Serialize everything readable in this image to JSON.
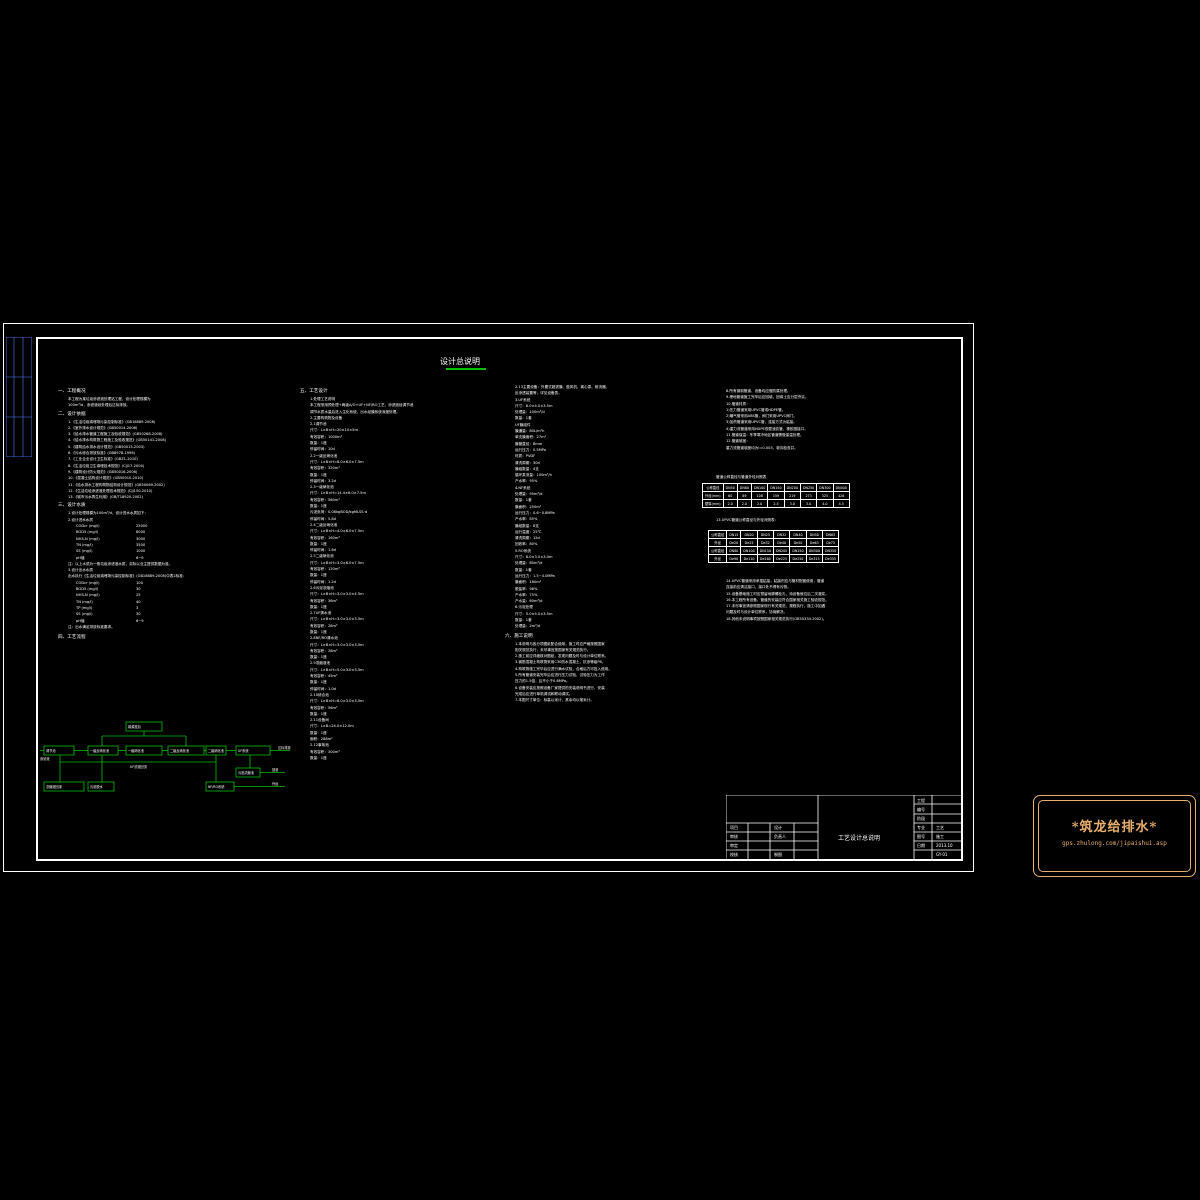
{
  "drawing": {
    "title": "设计总说明",
    "line_color": "#00c000",
    "text_color": "#ffffff"
  },
  "section1": {
    "heading": "一、工程概况",
    "lines": [
      "本工程为某垃圾渗滤液处理站工程，设计处理规模为",
      "100m³/d，渗滤液经处理后达标排放。"
    ]
  },
  "section2": {
    "heading": "二、设计依据",
    "lines": [
      "1.《生活垃圾填埋场污染控制标准》(GB16889-2008)",
      "2.《室外排水设计规范》(GB50014-2006)",
      "3.《给水排水管道工程施工及验收规范》(GB50268-2008)",
      "4.《给水排水构筑物工程施工及验收规范》(GB50141-2008)",
      "5.《建筑给水排水设计规范》(GB50015-2003)",
      "6.《污水综合排放标准》(GB8978-1996)",
      "7.《工业企业设计卫生标准》(GBZ1-2010)",
      "8.《生活垃圾卫生填埋技术规范》(CJJ17-2004)",
      "9.《建筑设计防火规范》(GB50016-2006)",
      "10.《混凝土结构设计规范》(GB50010-2010)",
      "11.《给水排水工程构筑物结构设计规范》(GB50069-2002)",
      "12.《生活垃圾渗滤液处理技术规范》(CJJ150-2010)",
      "13.《城市污水再生利用》(GB/T18920-2002)"
    ]
  },
  "section3": {
    "heading": "三、设计水质",
    "intro": "1.设计处理规模为100m³/d，设计进水水质如下：",
    "inlet_title": "2.设计进水水质",
    "inlet": [
      {
        "name": "CODcr (mg/l)",
        "value": "25000"
      },
      {
        "name": "BOD5 (mg/l)",
        "value": "8000"
      },
      {
        "name": "NH3-N (mg/l)",
        "value": "3000"
      },
      {
        "name": "TN (mg/l)",
        "value": "3500"
      },
      {
        "name": "SS (mg/l)",
        "value": "1000"
      },
      {
        "name": "pH值",
        "value": "6~9"
      }
    ],
    "note1": "注：以上水质为一般垃圾渗滤液水质，实际以业主提供数据为准。",
    "outlet_title": "3.设计出水水质",
    "outlet_intro": "出水执行《生活垃圾填埋场污染控制标准》(GB16889-2008)中表2标准：",
    "outlet": [
      {
        "name": "CODcr (mg/l)",
        "value": "100"
      },
      {
        "name": "BOD5 (mg/l)",
        "value": "30"
      },
      {
        "name": "NH3-N (mg/l)",
        "value": "25"
      },
      {
        "name": "TN (mg/l)",
        "value": "40"
      },
      {
        "name": "TP (mg/l)",
        "value": "3"
      },
      {
        "name": "SS (mg/l)",
        "value": "30"
      },
      {
        "name": "pH值",
        "value": "6~9"
      }
    ],
    "note2": "注：出水满足排放标准要求。"
  },
  "section4": {
    "heading": "四、工艺流程",
    "flow": {
      "b1": "调节池",
      "b2": "一级反硝化池",
      "b3": "一级硝化池",
      "b4": "二级反硝化池",
      "b5": "二级硝化池",
      "b6": "UF系统",
      "b7": "NF/RO系统",
      "top": "碳源投加",
      "sludge": "污泥浓缩池",
      "sludge2": "污泥脱水",
      "conc": "浓缩液回灌",
      "return": "UF浓液回流",
      "out1": "达标排放",
      "out2": "回灌",
      "out3": "外运",
      "in": "渗滤液"
    }
  },
  "section5": {
    "heading": "五、工艺设计",
    "lines": [
      "1.处理工艺说明",
      "本工程采用预处理+两级A/O+UF+NF/RO工艺，渗滤液经调节池",
      "调节水质水量后进入生化系统，出水经膜系统深度处理。",
      "2.主要构筑物及设备",
      "2.1调节池",
      "尺寸：L×B×H=20×10×5m",
      "有效容积：1000m³",
      "数量：1座",
      "停留时间：10d",
      "2.2一级反硝化池",
      "尺寸：L×B×H=8.0×6.0×7.5m",
      "有效容积：320m³",
      "数量：1座",
      "停留时间：3.2d",
      "2.3一级硝化池",
      "尺寸：L×B×H=14.4×6.0×7.5m",
      "有效容积：580m³",
      "数量：1座",
      "污泥负荷：0.08kgBOD/kgMLSS·d",
      "停留时间：5.8d",
      "2.4二级反硝化池",
      "尺寸：L×B×H=4.0×6.0×7.5m",
      "有效容积：160m³",
      "数量：1座",
      "停留时间：1.6d",
      "2.5二级硝化池",
      "尺寸：L×B×H=3.0×6.0×7.5m",
      "有效容积：120m³",
      "数量：1座",
      "停留时间：1.2d",
      "2.6污泥浓缩池",
      "尺寸：L×B×H=3.0×3.0×4.5m",
      "有效容积：36m³",
      "数量：1座",
      "2.7UF清水池",
      "尺寸：L×B×H=3.0×3.0×3.5m",
      "有效容积：28m³",
      "数量：1座",
      "2.8NF/RO清水池",
      "尺寸：L×B×H=3.0×3.0×3.5m",
      "有效容积：28m³",
      "数量：1座",
      "2.9浓缩液池",
      "尺寸：L×B×H=5.0×3.0×3.5m",
      "有效容积：45m³",
      "数量：1座",
      "停留时间：1.0d",
      "2.10综合池",
      "尺寸：L×B×H=6.0×3.0×3.5m",
      "有效容积：56m³",
      "数量：1座",
      "2.11设备间",
      "尺寸：L×B=24.0×12.0m",
      "数量：1座",
      "面积：288m²",
      "2.12事故池",
      "有效容积：300m³",
      "数量：1座"
    ]
  },
  "section5b": {
    "lines": [
      "2.13主要设备：外置式超滤膜、鼓风机、离心泵、射流器、",
      "反渗透装置等，详见设备表。",
      "3.UF系统",
      "尺寸：8.0×4.0×3.5m",
      "处理量：100m³/d",
      "数量：1套",
      "UF膜组件",
      "膜通量：80L/m²h",
      "单支膜面积：27m²",
      "膜管直径：8mm",
      "运行压力：0.5MPa",
      "材质：PVDF",
      "清洗周期：30d",
      "膜组数量：4支",
      "循环泵流量：100m³/h",
      "产水率：95%",
      "4.NF系统",
      "处理量：95m³/d",
      "数量：1套",
      "膜面积：250m²",
      "运行压力：0.6~0.8MPa",
      "产水率：85%",
      "膜组数量：8支",
      "运行温度：25℃",
      "清洗周期：15d",
      "回收率：80%",
      "5.RO系统",
      "尺寸：6.0×3.0×3.0m",
      "处理量：80m³/d",
      "数量：1套",
      "运行压力：1.5~4.0MPa",
      "膜面积：180m²",
      "脱盐率：98%",
      "产水率：75%",
      "产水量：60m³/d",
      "6.污泥处理",
      "尺寸：5.0×4.0×3.5m",
      "数量：1套",
      "处理量：2m³/d"
    ]
  },
  "section6": {
    "heading": "六、施工说明",
    "lines": [
      "1.本说明与各分项图纸配合使用，施工时应严格按照国家",
      "相关规范执行，未尽事宜按国家有关规范执行。",
      "2.施工前应详细核对图纸，发现问题及时与设计单位联系。",
      "3.钢筋混凝土构筑物采用C30防水混凝土，抗渗等级P8。",
      "4.构筑物施工完毕后应进行满水试验，合格后方可投入使用。",
      "5.所有管道安装完毕后应进行压力试验，试验压力为工作",
      "压力的1.5倍，且不小于0.6MPa。",
      "6.设备安装应按照设备厂家提供的安装说明书进行，安装",
      "完成后应进行单机调试和联动调试。",
      "7.本图尺寸单位：标高以米计，其余均以毫米计。"
    ]
  },
  "section7": {
    "lines": [
      "8.所有钢制管道、设备均应做防腐处理。",
      "9.埋地管道施工完毕后应回填，回填土应分层夯实。",
      "10.管道材质：",
      "1)压力管道采用UPVC管或HDPE管。",
      "2)曝气管采用ABS管，阀门采用UPVC阀门。",
      "3)加药管道采用UPVC管，连接方式为粘接。",
      "4)重力流管道采用HDPE双壁波纹管，橡胶圈接口。",
      "11.管道保温：冬季寒冷地区管道需做保温处理。",
      "12.管道坡度：",
      "重力流管道坡度均为i=0.003，坡向检查井。"
    ],
    "table1_caption": "管道公称直径与管道外径对照表",
    "table1": [
      [
        "公称直径",
        "DN50",
        "DN80",
        "DN100",
        "DN150",
        "DN200",
        "DN250",
        "DN300",
        "DN400"
      ],
      [
        "外径(mm)",
        "60",
        "89",
        "108",
        "159",
        "219",
        "273",
        "325",
        "426"
      ],
      [
        "壁厚(mm)",
        "2.0",
        "2.0",
        "2.0",
        "2.5",
        "3.0",
        "3.0",
        "4.0",
        "4.5"
      ]
    ],
    "table2_caption": "13.UPVC管道公称直径与外径对照表：",
    "table2": [
      [
        "公称直径",
        "DN15",
        "DN20",
        "DN25",
        "DN32",
        "DN40",
        "DN50",
        "DN65"
      ],
      [
        "外径",
        "De20",
        "De25",
        "De32",
        "De40",
        "De50",
        "De63",
        "De75"
      ],
      [
        "公称直径",
        "DN80",
        "DN100",
        "DN150",
        "DN200",
        "DN250",
        "DN300",
        "DN350"
      ],
      [
        "外径",
        "De90",
        "De110",
        "De160",
        "De225",
        "De250",
        "De315",
        "De355"
      ]
    ],
    "after": [
      "14.UPVC管道采用承插粘接，粘接剂应与管材配套使用，管道",
      "连接前应清洁接口，接口处不得有污物。",
      "15.设备基础施工时应预留地脚螺栓孔，待设备就位后二次灌浆。",
      "16.本工程所有设备、管道的安装应符合国家相关施工验收规范。",
      "17.未尽事宜请参照国家现行有关规范、规程执行，施工中如遇",
      "问题及时与设计单位联系，协商解决。",
      "18.其他未说明事项按照国家相关规范执行(GB50334-2002)。"
    ]
  },
  "title_block": {
    "drawing_name": "工艺设计总说明",
    "r1": "项目",
    "r2": "审核",
    "r3": "审定",
    "r4": "校核",
    "c1": "设计",
    "c2": "负责人",
    "c3": "制图",
    "k1": "工程",
    "k2": "编号",
    "k3": "阶段",
    "k4": "专业",
    "k5": "图号",
    "k6": "日期",
    "v4": "工艺",
    "v5": "施工",
    "v6": "2013.10",
    "v7": "GY-01"
  },
  "binding_labels": [
    "会签",
    "校对",
    "审核"
  ],
  "watermark": {
    "title": "*筑龙给排水*",
    "url": "gps.zhulong.com/jipaishui.asp",
    "color": "#e9b06c"
  }
}
